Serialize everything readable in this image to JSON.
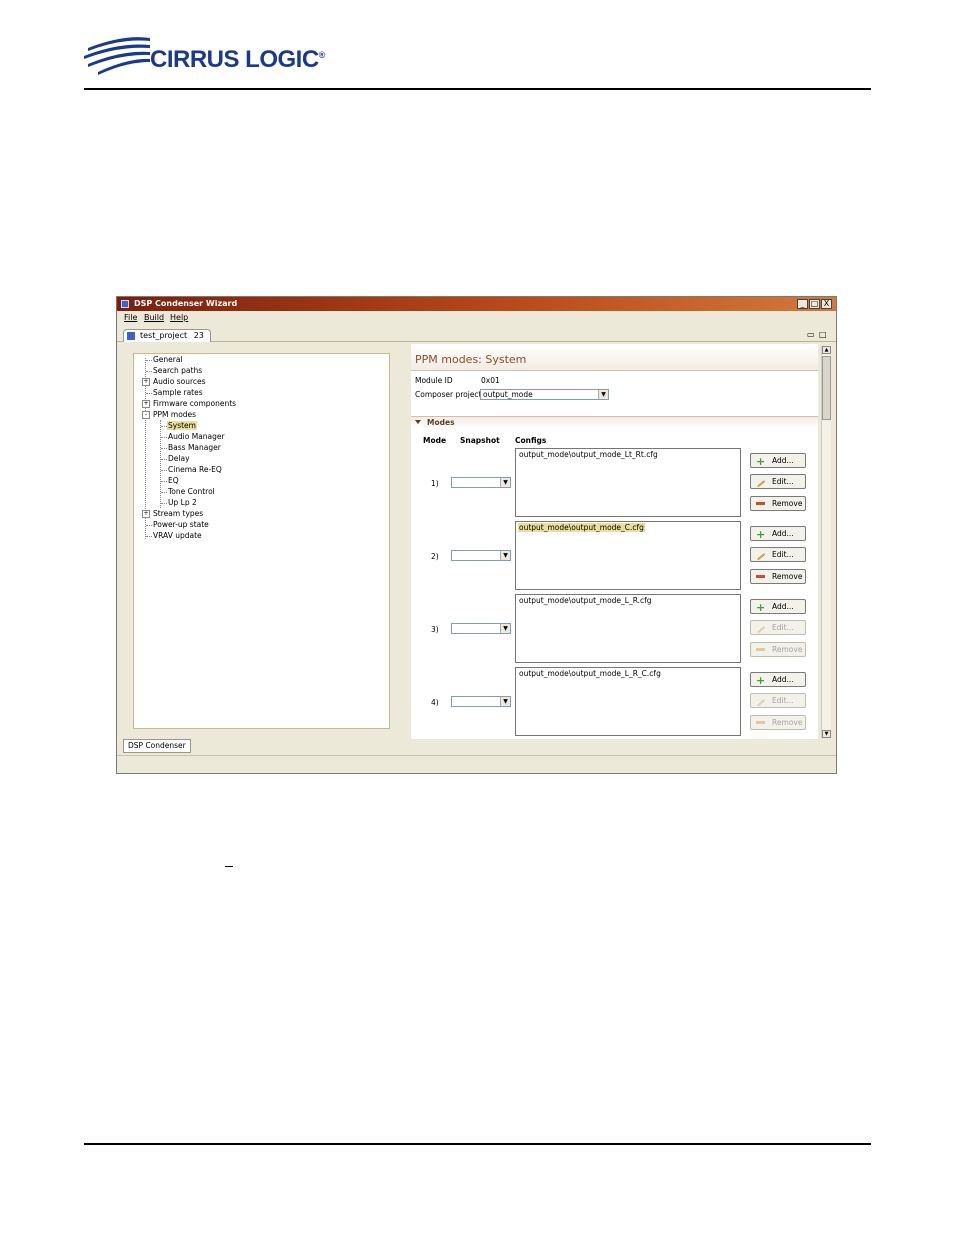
{
  "brand": {
    "name": "CIRRUS LOGIC",
    "mark": "®"
  },
  "window": {
    "title": "DSP Condenser Wizard",
    "buttons": [
      "_",
      "□",
      "X"
    ],
    "menu": [
      "File",
      "Build",
      "Help"
    ],
    "editor_tab": "test_project",
    "editor_tab_badge": "23",
    "view_controls": [
      "▭",
      "□"
    ]
  },
  "tree": [
    {
      "label": "General",
      "level": 0
    },
    {
      "label": "Search paths",
      "level": 0
    },
    {
      "label": "Audio sources",
      "level": 0,
      "expander": "+"
    },
    {
      "label": "Sample rates",
      "level": 0
    },
    {
      "label": "Firmware components",
      "level": 0,
      "expander": "+"
    },
    {
      "label": "PPM modes",
      "level": 0,
      "expander": "-"
    },
    {
      "label": "System",
      "level": 1,
      "selected": true
    },
    {
      "label": "Audio Manager",
      "level": 1
    },
    {
      "label": "Bass Manager",
      "level": 1
    },
    {
      "label": "Delay",
      "level": 1
    },
    {
      "label": "Cinema Re-EQ",
      "level": 1
    },
    {
      "label": "EQ",
      "level": 1
    },
    {
      "label": "Tone Control",
      "level": 1
    },
    {
      "label": "Up Lp 2",
      "level": 1
    },
    {
      "label": "Stream types",
      "level": 0,
      "expander": "+"
    },
    {
      "label": "Power-up state",
      "level": 0
    },
    {
      "label": "VRAV update",
      "level": 0
    }
  ],
  "panel": {
    "title": "PPM modes: System",
    "module_id_label": "Module ID",
    "module_id_value": "0x01",
    "composer_label": "Composer project",
    "composer_value": "output_mode",
    "section": "Modes",
    "columns": {
      "mode": "Mode",
      "snapshot": "Snapshot",
      "configs": "Configs"
    }
  },
  "modes": [
    {
      "num": "1)",
      "snapshot": "",
      "config": "output_mode\\output_mode_Lt_Rt.cfg",
      "selected": false,
      "edit_enabled": true,
      "remove_enabled": true
    },
    {
      "num": "2)",
      "snapshot": "",
      "config": "output_mode\\output_mode_C.cfg",
      "selected": true,
      "edit_enabled": true,
      "remove_enabled": true
    },
    {
      "num": "3)",
      "snapshot": "",
      "config": "output_mode\\output_mode_L_R.cfg",
      "selected": false,
      "edit_enabled": false,
      "remove_enabled": false
    },
    {
      "num": "4)",
      "snapshot": "",
      "config": "output_mode\\output_mode_L_R_C.cfg",
      "selected": false,
      "edit_enabled": false,
      "remove_enabled": false
    }
  ],
  "buttons": {
    "add": "Add...",
    "edit": "Edit...",
    "remove": "Remove"
  },
  "bottom_tab": "DSP Condenser",
  "colors": {
    "titlebar": "#8b2a10",
    "selection": "#e8df9a",
    "panel_title": "#8a4d28",
    "brand_blue": "#1a3a8f"
  }
}
